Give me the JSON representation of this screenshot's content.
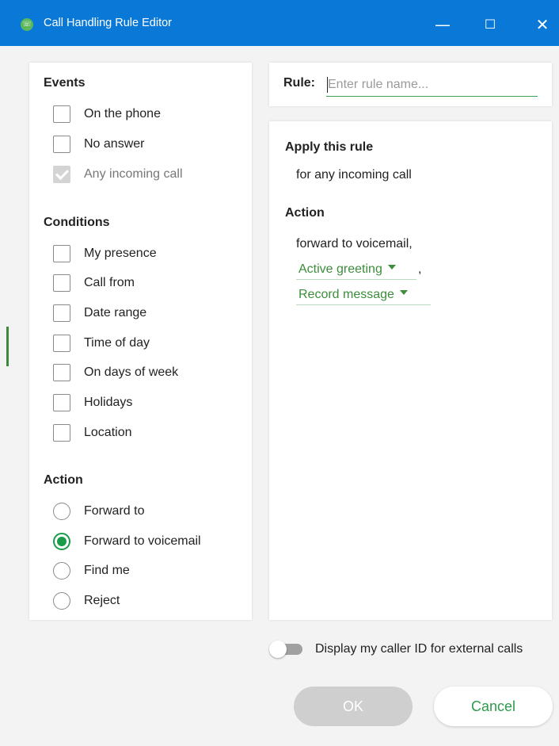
{
  "window": {
    "title": "Call Handling Rule Editor",
    "app_icon_text": "☏",
    "minimize": "—",
    "maximize": "☐",
    "close": "✕"
  },
  "events": {
    "title": "Events",
    "items": [
      {
        "label": "On the phone",
        "checked": false,
        "disabled": false
      },
      {
        "label": "No answer",
        "checked": false,
        "disabled": false
      },
      {
        "label": "Any incoming call",
        "checked": true,
        "disabled": true
      }
    ]
  },
  "conditions": {
    "title": "Conditions",
    "items": [
      {
        "label": "My presence",
        "checked": false
      },
      {
        "label": "Call from",
        "checked": false
      },
      {
        "label": "Date range",
        "checked": false
      },
      {
        "label": "Time of day",
        "checked": false
      },
      {
        "label": "On days of week",
        "checked": false
      },
      {
        "label": "Holidays",
        "checked": false
      },
      {
        "label": "Location",
        "checked": false
      }
    ]
  },
  "action": {
    "title": "Action",
    "options": [
      {
        "label": "Forward to",
        "selected": false
      },
      {
        "label": "Forward to voicemail",
        "selected": true
      },
      {
        "label": "Find me",
        "selected": false
      },
      {
        "label": "Reject",
        "selected": false
      }
    ]
  },
  "rule": {
    "label": "Rule:",
    "value": "",
    "placeholder": "Enter rule name..."
  },
  "summary": {
    "apply_title": "Apply this rule",
    "apply_text": "for any incoming call",
    "action_title": "Action",
    "action_text": "forward to voicemail,",
    "greeting_dropdown": "Active greeting",
    "greeting_suffix": ",",
    "record_dropdown": "Record message"
  },
  "caller_id": {
    "label": "Display my caller ID for external calls",
    "enabled": false
  },
  "buttons": {
    "ok": "OK",
    "cancel": "Cancel"
  },
  "colors": {
    "titlebar": "#0a78d7",
    "accent_green": "#1a9b4a",
    "dropdown_green": "#3c8d3c"
  }
}
